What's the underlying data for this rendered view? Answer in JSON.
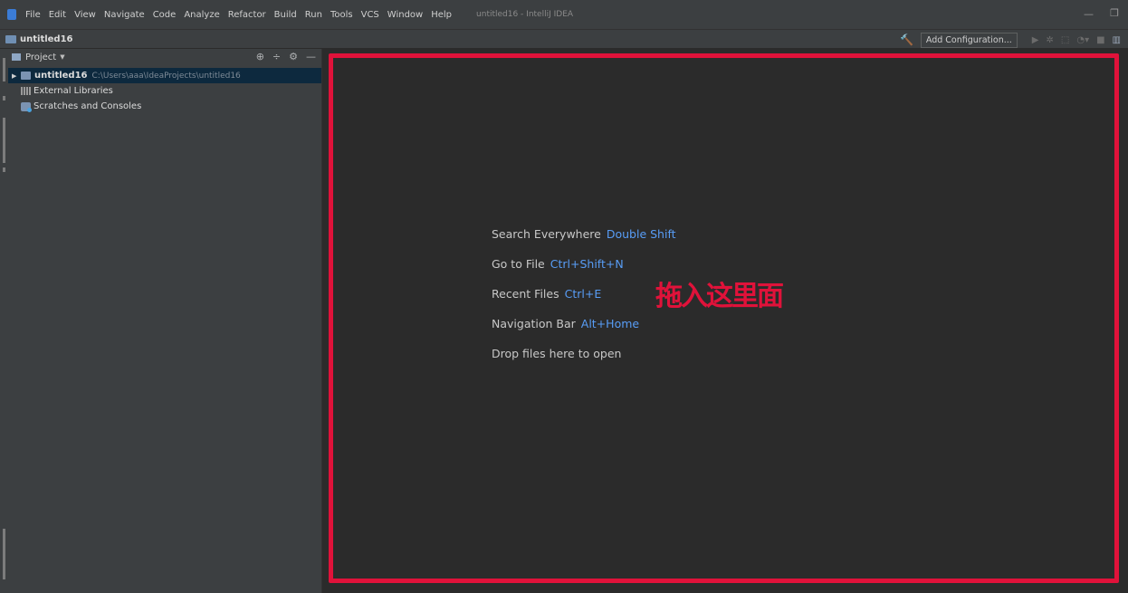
{
  "menubar": {
    "items": [
      "File",
      "Edit",
      "View",
      "Navigate",
      "Code",
      "Analyze",
      "Refactor",
      "Build",
      "Run",
      "Tools",
      "VCS",
      "Window",
      "Help"
    ],
    "window_title": "untitled16 - IntelliJ IDEA"
  },
  "navbar": {
    "project": "untitled16",
    "add_configuration": "Add Configuration..."
  },
  "project_panel": {
    "title": "Project",
    "tree": {
      "root_name": "untitled16",
      "root_path": "C:\\Users\\aaa\\IdeaProjects\\untitled16",
      "external_libraries": "External Libraries",
      "scratches": "Scratches and Consoles"
    }
  },
  "editor": {
    "hints": [
      {
        "label": "Search Everywhere",
        "shortcut": "Double Shift"
      },
      {
        "label": "Go to File",
        "shortcut": "Ctrl+Shift+N"
      },
      {
        "label": "Recent Files",
        "shortcut": "Ctrl+E"
      },
      {
        "label": "Navigation Bar",
        "shortcut": "Alt+Home"
      },
      {
        "label": "Drop files here to open",
        "shortcut": ""
      }
    ],
    "annotation": "拖入这里面"
  },
  "colors": {
    "highlight": "#e0123a",
    "shortcut": "#589df6",
    "editor_bg": "#2b2b2b",
    "panel_bg": "#3c3f41"
  }
}
